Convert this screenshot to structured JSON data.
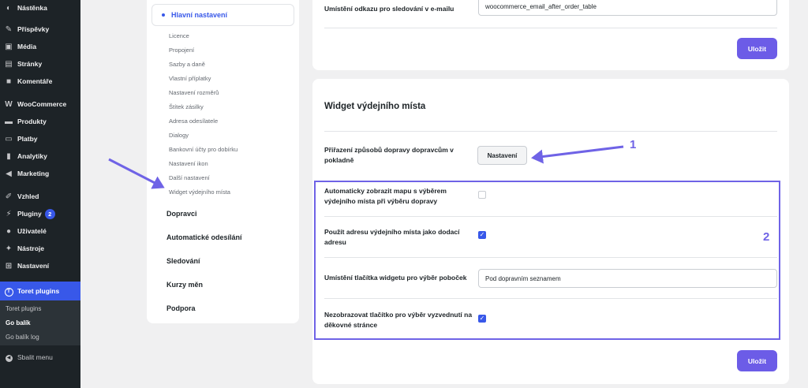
{
  "admin_menu": {
    "items": [
      {
        "label": "Nástěnka",
        "icon": "dashboard-icon"
      },
      {
        "label": "Příspěvky",
        "icon": "pin-icon"
      },
      {
        "label": "Média",
        "icon": "media-icon"
      },
      {
        "label": "Stránky",
        "icon": "page-icon"
      },
      {
        "label": "Komentáře",
        "icon": "comment-icon"
      },
      {
        "label": "WooCommerce",
        "icon": "woo-icon"
      },
      {
        "label": "Produkty",
        "icon": "archive-icon"
      },
      {
        "label": "Platby",
        "icon": "card-icon"
      },
      {
        "label": "Analytiky",
        "icon": "bar-chart-icon"
      },
      {
        "label": "Marketing",
        "icon": "megaphone-icon"
      },
      {
        "label": "Vzhled",
        "icon": "brush-icon"
      },
      {
        "label": "Pluginy",
        "icon": "plug-icon",
        "badge": "2"
      },
      {
        "label": "Uživatelé",
        "icon": "user-icon"
      },
      {
        "label": "Nástroje",
        "icon": "wrench-icon"
      },
      {
        "label": "Nastavení",
        "icon": "settings-icon"
      },
      {
        "label": "Toret plugins",
        "icon": "toret-icon"
      }
    ],
    "submenu": [
      "Toret plugins",
      "Go balík",
      "Go balík log"
    ],
    "collapse_label": "Sbalit menu",
    "accent_color": "#3858e9"
  },
  "settings_nav": {
    "active": "Hlavní nastavení",
    "sub_items": [
      "Licence",
      "Propojení",
      "Sazby a daně",
      "Vlastní příplatky",
      "Nastavení rozměrů",
      "Štítek zásilky",
      "Adresa odesílatele",
      "Dialogy",
      "Bankovní účty pro dobírku",
      "Nastavení ikon",
      "Další nastavení",
      "Widget výdejního místa"
    ],
    "main_items": [
      "Dopravci",
      "Automatické odesílání",
      "Sledování",
      "Kurzy měn",
      "Podpora"
    ]
  },
  "top_card": {
    "tracking_label": "Umístění odkazu pro sledování v e-mailu",
    "tracking_value": "woocommerce_email_after_order_table",
    "save_label": "Uložit"
  },
  "widget_card": {
    "title": "Widget výdejního místa",
    "assign_label": "Přiřazení způsobů dopravy dopravcům v pokladně",
    "assign_button": "Nastavení",
    "auto_map_label": "Automaticky zobrazit mapu s výběrem výdejního místa při výběru dopravy",
    "use_address_label": "Použít adresu výdejního místa jako dodací adresu",
    "button_position_label": "Umístění tlačítka widgetu pro výběr poboček",
    "button_position_value": "Pod dopravním seznamem",
    "hide_button_label": "Nezobrazovat tlačítko pro výběr vyzvednutí na děkovné stránce",
    "checkbox_states": {
      "auto_map": false,
      "use_address": true,
      "hide_button": true
    },
    "save_label": "Uložit"
  },
  "annotations": {
    "one": "1",
    "two": "2",
    "color": "#6f63e6"
  }
}
